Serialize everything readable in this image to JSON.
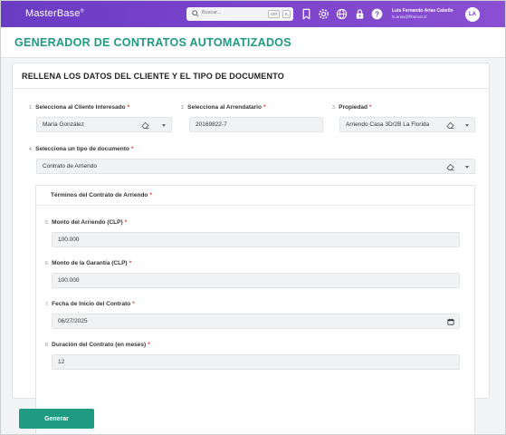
{
  "app": {
    "logo": "MasterBase",
    "logo_mark": "®"
  },
  "topbar": {
    "search_placeholder": "Buscar...",
    "shortcut_ctrl": "Ctrl",
    "shortcut_key": "K",
    "icons": [
      "bookmark-icon",
      "settings-icon",
      "globe-icon",
      "lock-icon",
      "help-icon"
    ],
    "user_name": "Luis Fernando Arias Cabello",
    "user_email": "lu.arias@fibamar.cl",
    "avatar_initials": "LA"
  },
  "page": {
    "title": "GENERADOR DE CONTRATOS AUTOMATIZADOS"
  },
  "form": {
    "section_title": "RELLENA LOS DATOS DEL CLIENTE Y EL TIPO DE DOCUMENTO",
    "required_mark": "*",
    "client": {
      "num": "1.",
      "label": "Selecciona al Cliente Interesado",
      "value": "María González"
    },
    "tenant": {
      "num": "2.",
      "label": "Selecciona al Arrendatario",
      "value": "20169822-7"
    },
    "property": {
      "num": "3.",
      "label": "Propiedad",
      "value": "Arriendo Casa 3D/2B La Florida"
    },
    "doc_type": {
      "num": "4.",
      "label": "Selecciona un tipo de documento",
      "value": "Contrato de Arriendo"
    },
    "terms": {
      "title": "Términos del Contrato de Arriendo",
      "rent": {
        "num": "5.",
        "label": "Monto del Arriendo (CLP)",
        "value": "100.000"
      },
      "deposit": {
        "num": "6.",
        "label": "Monto de la Garantía (CLP)",
        "value": "100.000"
      },
      "start_date": {
        "num": "7.",
        "label": "Fecha de Inicio del Contrato",
        "value": "06/27/2025"
      },
      "duration": {
        "num": "8.",
        "label": "Duración del Contrato (en meses)",
        "value": "12"
      }
    },
    "submit_label": "Generar"
  },
  "colors": {
    "topbar": "#7d45cc",
    "accent": "#1f9b82",
    "required": "#e03a3a"
  }
}
